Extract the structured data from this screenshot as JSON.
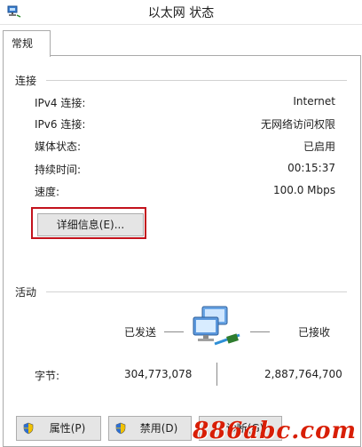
{
  "window": {
    "title": "以太网 状态",
    "icon": "network-window-icon"
  },
  "tabs": [
    {
      "label": "常规"
    }
  ],
  "connection": {
    "group_title": "连接",
    "rows": [
      {
        "label": "IPv4 连接:",
        "value": "Internet"
      },
      {
        "label": "IPv6 连接:",
        "value": "无网络访问权限"
      },
      {
        "label": "媒体状态:",
        "value": "已启用"
      },
      {
        "label": "持续时间:",
        "value": "00:15:37"
      },
      {
        "label": "速度:",
        "value": "100.0 Mbps"
      }
    ],
    "details_button": "详细信息(E)...",
    "highlight_color": "#c3121c"
  },
  "activity": {
    "group_title": "活动",
    "sent_label": "已发送",
    "received_label": "已接收",
    "bytes_label": "字节:",
    "bytes_sent": "304,773,078",
    "bytes_received": "2,887,764,700",
    "icon": "network-computers-icon"
  },
  "buttons": {
    "properties": "属性(P)",
    "disable": "禁用(D)",
    "diagnose": "诊断(G)",
    "shield_icon": "uac-shield-icon"
  },
  "watermark": {
    "text": "886abc.com",
    "color": "#d81e06"
  }
}
